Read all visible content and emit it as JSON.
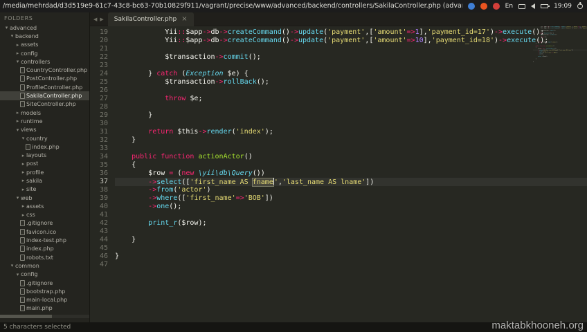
{
  "titlebar": {
    "title": "/media/mehrdad/d3d519e9-61c7-43c8-bc63-70b10829f911/vagrant/precise/www/advanced/backend/controllers/SakilaController.php (advan",
    "tray": [
      {
        "name": "app-icon-blue",
        "type": "dot",
        "color": "#3f7fd6"
      },
      {
        "name": "app-icon-orange",
        "type": "dot",
        "color": "#e95420"
      },
      {
        "name": "app-icon-red",
        "type": "dot",
        "color": "#d43f3a"
      },
      {
        "name": "input-language-indicator",
        "type": "label",
        "label": "En"
      },
      {
        "name": "mail-icon",
        "type": "mail"
      },
      {
        "name": "volume-icon",
        "type": "volume"
      },
      {
        "name": "battery-icon",
        "type": "battery"
      },
      {
        "name": "clock",
        "type": "label",
        "label": "19:09"
      },
      {
        "name": "power-icon",
        "type": "power"
      }
    ]
  },
  "sidebar": {
    "header": "FOLDERS",
    "items": [
      {
        "label": "advanced",
        "level": 0,
        "kind": "folder-open"
      },
      {
        "label": "backend",
        "level": 1,
        "kind": "folder-open"
      },
      {
        "label": "assets",
        "level": 2,
        "kind": "folder-closed"
      },
      {
        "label": "config",
        "level": 2,
        "kind": "folder-closed"
      },
      {
        "label": "controllers",
        "level": 2,
        "kind": "folder-open"
      },
      {
        "label": "CountryController.php",
        "level": 3,
        "kind": "file"
      },
      {
        "label": "PostController.php",
        "level": 3,
        "kind": "file"
      },
      {
        "label": "ProfileController.php",
        "level": 3,
        "kind": "file"
      },
      {
        "label": "SakilaController.php",
        "level": 3,
        "kind": "file",
        "selected": true
      },
      {
        "label": "SiteController.php",
        "level": 3,
        "kind": "file"
      },
      {
        "label": "models",
        "level": 2,
        "kind": "folder-closed"
      },
      {
        "label": "runtime",
        "level": 2,
        "kind": "folder-closed"
      },
      {
        "label": "views",
        "level": 2,
        "kind": "folder-open"
      },
      {
        "label": "country",
        "level": 3,
        "kind": "folder-open"
      },
      {
        "label": "index.php",
        "level": 4,
        "kind": "file"
      },
      {
        "label": "layouts",
        "level": 3,
        "kind": "folder-closed"
      },
      {
        "label": "post",
        "level": 3,
        "kind": "folder-closed"
      },
      {
        "label": "profile",
        "level": 3,
        "kind": "folder-closed"
      },
      {
        "label": "sakila",
        "level": 3,
        "kind": "folder-closed"
      },
      {
        "label": "site",
        "level": 3,
        "kind": "folder-closed"
      },
      {
        "label": "web",
        "level": 2,
        "kind": "folder-open"
      },
      {
        "label": "assets",
        "level": 3,
        "kind": "folder-closed"
      },
      {
        "label": "css",
        "level": 3,
        "kind": "folder-closed"
      },
      {
        "label": ".gitignore",
        "level": 3,
        "kind": "file"
      },
      {
        "label": "favicon.ico",
        "level": 3,
        "kind": "file"
      },
      {
        "label": "index-test.php",
        "level": 3,
        "kind": "file"
      },
      {
        "label": "index.php",
        "level": 3,
        "kind": "file"
      },
      {
        "label": "robots.txt",
        "level": 3,
        "kind": "file"
      },
      {
        "label": "common",
        "level": 1,
        "kind": "folder-open"
      },
      {
        "label": "config",
        "level": 2,
        "kind": "folder-open"
      },
      {
        "label": ".gitignore",
        "level": 3,
        "kind": "file"
      },
      {
        "label": "bootstrap.php",
        "level": 3,
        "kind": "file"
      },
      {
        "label": "main-local.php",
        "level": 3,
        "kind": "file"
      },
      {
        "label": "main.php",
        "level": 3,
        "kind": "file"
      }
    ]
  },
  "tabs": {
    "scroll_left_icon": "◀",
    "scroll_right_icon": "▶",
    "active_label": "SakilaController.php",
    "close_icon": "×"
  },
  "editor": {
    "lines": [
      {
        "n": 19,
        "tokens": [
          [
            "pln",
            "            "
          ],
          [
            "pln",
            "Yii"
          ],
          [
            "op",
            "::"
          ],
          [
            "var",
            "$app"
          ],
          [
            "op",
            "->"
          ],
          [
            "var",
            "db"
          ],
          [
            "op",
            "->"
          ],
          [
            "fn",
            "createCommand"
          ],
          [
            "pln",
            "()"
          ],
          [
            "op",
            "->"
          ],
          [
            "fn",
            "update"
          ],
          [
            "pln",
            "("
          ],
          [
            "str",
            "'payment'"
          ],
          [
            "pln",
            ",["
          ],
          [
            "str",
            "'amount'"
          ],
          [
            "op",
            "=>"
          ],
          [
            "num",
            "1"
          ],
          [
            "pln",
            "],"
          ],
          [
            "str",
            "'payment_id=17'"
          ],
          [
            "pln",
            ")"
          ],
          [
            "op",
            "->"
          ],
          [
            "fn",
            "execute"
          ],
          [
            "pln",
            "();"
          ]
        ]
      },
      {
        "n": 20,
        "tokens": [
          [
            "pln",
            "            "
          ],
          [
            "pln",
            "Yii"
          ],
          [
            "op",
            "::"
          ],
          [
            "var",
            "$app"
          ],
          [
            "op",
            "->"
          ],
          [
            "var",
            "db"
          ],
          [
            "op",
            "->"
          ],
          [
            "fn",
            "createCommand"
          ],
          [
            "pln",
            "()"
          ],
          [
            "op",
            "->"
          ],
          [
            "fn",
            "update"
          ],
          [
            "pln",
            "("
          ],
          [
            "str",
            "'payment'"
          ],
          [
            "pln",
            ",["
          ],
          [
            "str",
            "'amount'"
          ],
          [
            "op",
            "=>"
          ],
          [
            "num",
            "10"
          ],
          [
            "pln",
            "],"
          ],
          [
            "str",
            "'payment_id=18'"
          ],
          [
            "pln",
            ")"
          ],
          [
            "op",
            "->"
          ],
          [
            "fn",
            "execute"
          ],
          [
            "pln",
            "();"
          ]
        ]
      },
      {
        "n": 21,
        "tokens": []
      },
      {
        "n": 22,
        "tokens": [
          [
            "pln",
            "            "
          ],
          [
            "var",
            "$transaction"
          ],
          [
            "op",
            "->"
          ],
          [
            "fn",
            "commit"
          ],
          [
            "pln",
            "();"
          ]
        ]
      },
      {
        "n": 23,
        "tokens": []
      },
      {
        "n": 24,
        "tokens": [
          [
            "pln",
            "        } "
          ],
          [
            "kw",
            "catch"
          ],
          [
            "pln",
            " ("
          ],
          [
            "cls",
            "Exception"
          ],
          [
            "pln",
            " "
          ],
          [
            "var",
            "$e"
          ],
          [
            "pln",
            ") {"
          ]
        ]
      },
      {
        "n": 25,
        "tokens": [
          [
            "pln",
            "            "
          ],
          [
            "var",
            "$transaction"
          ],
          [
            "op",
            "->"
          ],
          [
            "fn",
            "rollBack"
          ],
          [
            "pln",
            "();"
          ]
        ]
      },
      {
        "n": 26,
        "tokens": []
      },
      {
        "n": 27,
        "tokens": [
          [
            "pln",
            "            "
          ],
          [
            "kw",
            "throw"
          ],
          [
            "pln",
            " "
          ],
          [
            "var",
            "$e"
          ],
          [
            "pln",
            ";"
          ]
        ]
      },
      {
        "n": 28,
        "tokens": []
      },
      {
        "n": 29,
        "tokens": [
          [
            "pln",
            "        }"
          ]
        ]
      },
      {
        "n": 30,
        "tokens": []
      },
      {
        "n": 31,
        "tokens": [
          [
            "pln",
            "        "
          ],
          [
            "kw",
            "return"
          ],
          [
            "pln",
            " "
          ],
          [
            "var",
            "$this"
          ],
          [
            "op",
            "->"
          ],
          [
            "fn",
            "render"
          ],
          [
            "pln",
            "("
          ],
          [
            "str",
            "'index'"
          ],
          [
            "pln",
            ");"
          ]
        ]
      },
      {
        "n": 32,
        "tokens": [
          [
            "pln",
            "    }"
          ]
        ]
      },
      {
        "n": 33,
        "tokens": []
      },
      {
        "n": 34,
        "tokens": [
          [
            "pln",
            "    "
          ],
          [
            "kw",
            "public"
          ],
          [
            "pln",
            " "
          ],
          [
            "kw",
            "function"
          ],
          [
            "pln",
            " "
          ],
          [
            "def",
            "actionActor"
          ],
          [
            "pln",
            "()"
          ]
        ]
      },
      {
        "n": 35,
        "tokens": [
          [
            "pln",
            "    {"
          ]
        ]
      },
      {
        "n": 36,
        "tokens": [
          [
            "pln",
            "        "
          ],
          [
            "var",
            "$row"
          ],
          [
            "pln",
            " "
          ],
          [
            "op",
            "="
          ],
          [
            "pln",
            " ("
          ],
          [
            "kw",
            "new"
          ],
          [
            "pln",
            " "
          ],
          [
            "cls",
            "\\yii\\db\\Query"
          ],
          [
            "pln",
            "())"
          ]
        ]
      },
      {
        "n": 37,
        "active": true,
        "tokens": [
          [
            "pln",
            "        "
          ],
          [
            "op",
            "->"
          ],
          [
            "fn",
            "select"
          ],
          [
            "pln",
            "(["
          ],
          [
            "str",
            "'first_name AS "
          ],
          [
            "sel",
            "fname"
          ],
          [
            "str",
            "'"
          ],
          [
            "pln",
            ","
          ],
          [
            "str",
            "'last_name AS lname'"
          ],
          [
            "pln",
            "])"
          ]
        ]
      },
      {
        "n": 38,
        "tokens": [
          [
            "pln",
            "        "
          ],
          [
            "op",
            "->"
          ],
          [
            "fn",
            "from"
          ],
          [
            "pln",
            "("
          ],
          [
            "str",
            "'actor'"
          ],
          [
            "pln",
            ")"
          ]
        ]
      },
      {
        "n": 39,
        "tokens": [
          [
            "pln",
            "        "
          ],
          [
            "op",
            "->"
          ],
          [
            "fn",
            "where"
          ],
          [
            "pln",
            "(["
          ],
          [
            "str",
            "'first_name'"
          ],
          [
            "op",
            "=>"
          ],
          [
            "str",
            "'BOB'"
          ],
          [
            "pln",
            "])"
          ]
        ]
      },
      {
        "n": 40,
        "tokens": [
          [
            "pln",
            "        "
          ],
          [
            "op",
            "->"
          ],
          [
            "fn",
            "one"
          ],
          [
            "pln",
            "();"
          ]
        ]
      },
      {
        "n": 41,
        "tokens": []
      },
      {
        "n": 42,
        "tokens": [
          [
            "pln",
            "        "
          ],
          [
            "fn",
            "print_r"
          ],
          [
            "pln",
            "("
          ],
          [
            "var",
            "$row"
          ],
          [
            "pln",
            ");"
          ]
        ]
      },
      {
        "n": 43,
        "tokens": []
      },
      {
        "n": 44,
        "tokens": [
          [
            "pln",
            "    }"
          ]
        ]
      },
      {
        "n": 45,
        "tokens": []
      },
      {
        "n": 46,
        "tokens": [
          [
            "pln",
            "}"
          ]
        ]
      },
      {
        "n": 47,
        "tokens": []
      }
    ]
  },
  "statusbar": {
    "left": "5 characters selected"
  },
  "watermark": "maktabkhooneh.org",
  "colors": {
    "editor_background": "#272822",
    "string": "#E6DB74",
    "keyword": "#F92672",
    "number": "#AE81FF",
    "function_call": "#66D9EF",
    "function_definition": "#A6E22E",
    "selection": "#49483E"
  }
}
